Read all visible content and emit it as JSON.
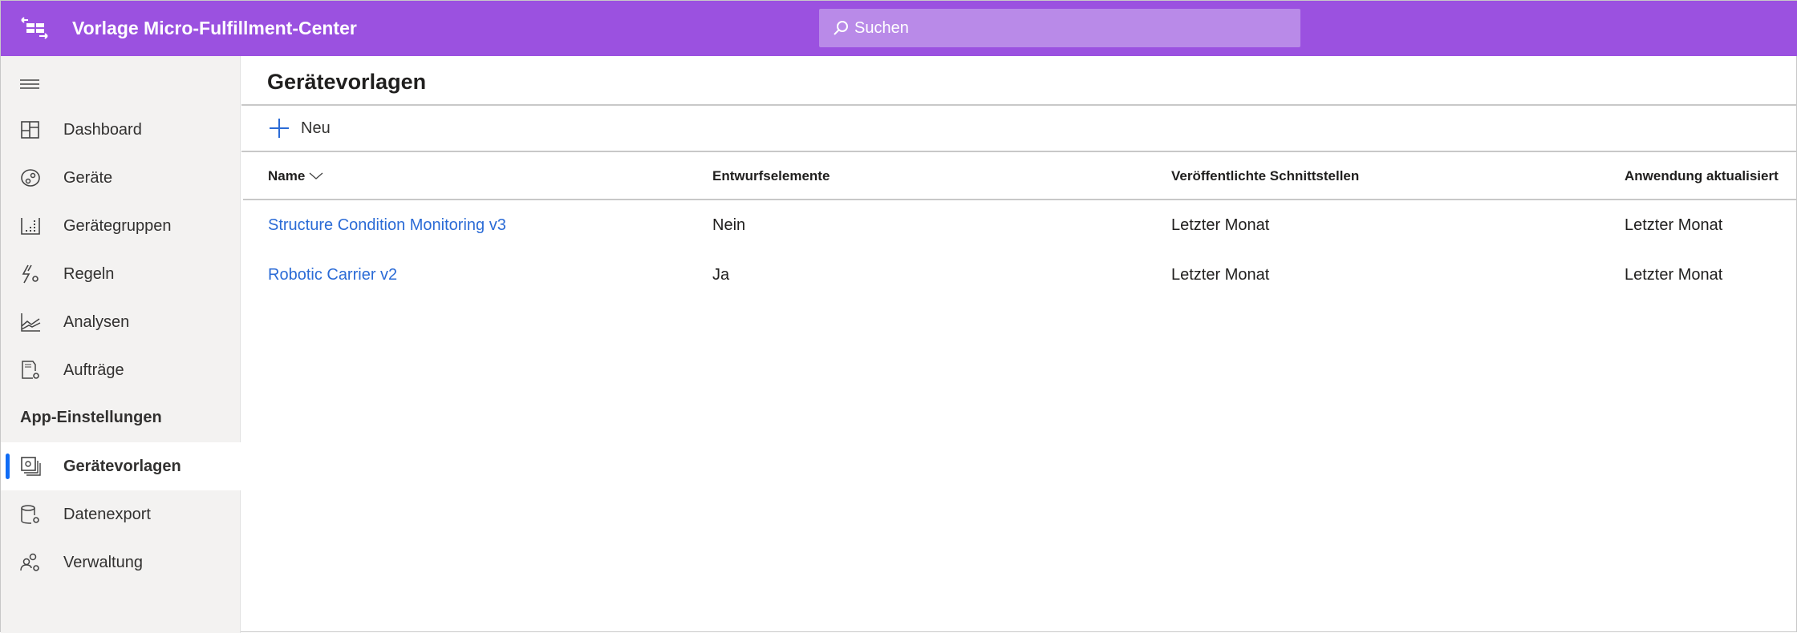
{
  "header": {
    "app_title": "Vorlage Micro-Fulfillment-Center",
    "search_placeholder": "Suchen",
    "accent": "#9b51e0"
  },
  "sidebar": {
    "items": [
      {
        "label": "Dashboard",
        "icon": "dashboard-icon"
      },
      {
        "label": "Geräte",
        "icon": "devices-icon"
      },
      {
        "label": "Gerätegruppen",
        "icon": "device-groups-icon"
      },
      {
        "label": "Regeln",
        "icon": "rules-icon"
      },
      {
        "label": "Analysen",
        "icon": "analytics-icon"
      },
      {
        "label": "Aufträge",
        "icon": "jobs-icon"
      }
    ],
    "section": "App-Einstellungen",
    "settings": [
      {
        "label": "Gerätevorlagen",
        "icon": "device-templates-icon",
        "active": true
      },
      {
        "label": "Datenexport",
        "icon": "data-export-icon"
      },
      {
        "label": "Verwaltung",
        "icon": "administration-icon"
      }
    ]
  },
  "main": {
    "title": "Gerätevorlagen",
    "new_label": "Neu",
    "columns": [
      "Name",
      "Entwurfselemente",
      "Veröffentlichte Schnittstellen",
      "Anwendung aktualisiert"
    ],
    "rows": [
      [
        "Structure Condition Monitoring v3",
        "Nein",
        "Letzter Monat",
        "Letzter Monat"
      ],
      [
        "Robotic Carrier v2",
        "Ja",
        "Letzter Monat",
        "Letzter Monat"
      ]
    ]
  }
}
